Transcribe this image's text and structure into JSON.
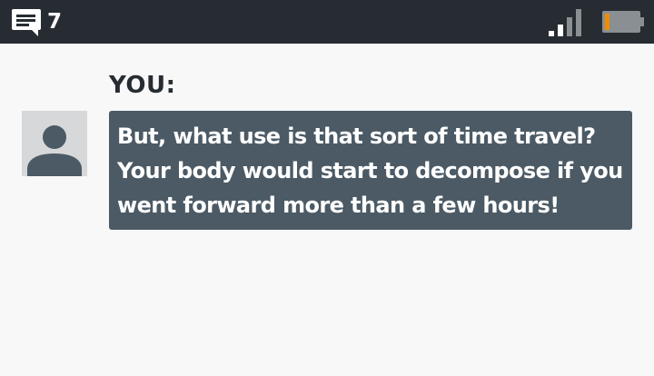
{
  "status_bar": {
    "message_icon": "message-icon",
    "message_count": "7",
    "signal_icon": "signal-icon",
    "signal_bars_active": 2,
    "signal_bars_total": 4,
    "battery_icon": "battery-icon",
    "battery_level": 0.15
  },
  "dialogue": {
    "speaker": "YOU:",
    "avatar_icon": "user-avatar-icon",
    "lines": [
      "But, what use is that sort of time travel?",
      "Your body would start to decompose if you",
      "went forward more than a few hours!"
    ]
  },
  "colors": {
    "status_bar_bg": "#262c31",
    "page_bg": "#f8f8f8",
    "bubble_bg": "#4b5a65",
    "battery_accent": "#f08c00",
    "icon_gray": "#8a8f93"
  }
}
